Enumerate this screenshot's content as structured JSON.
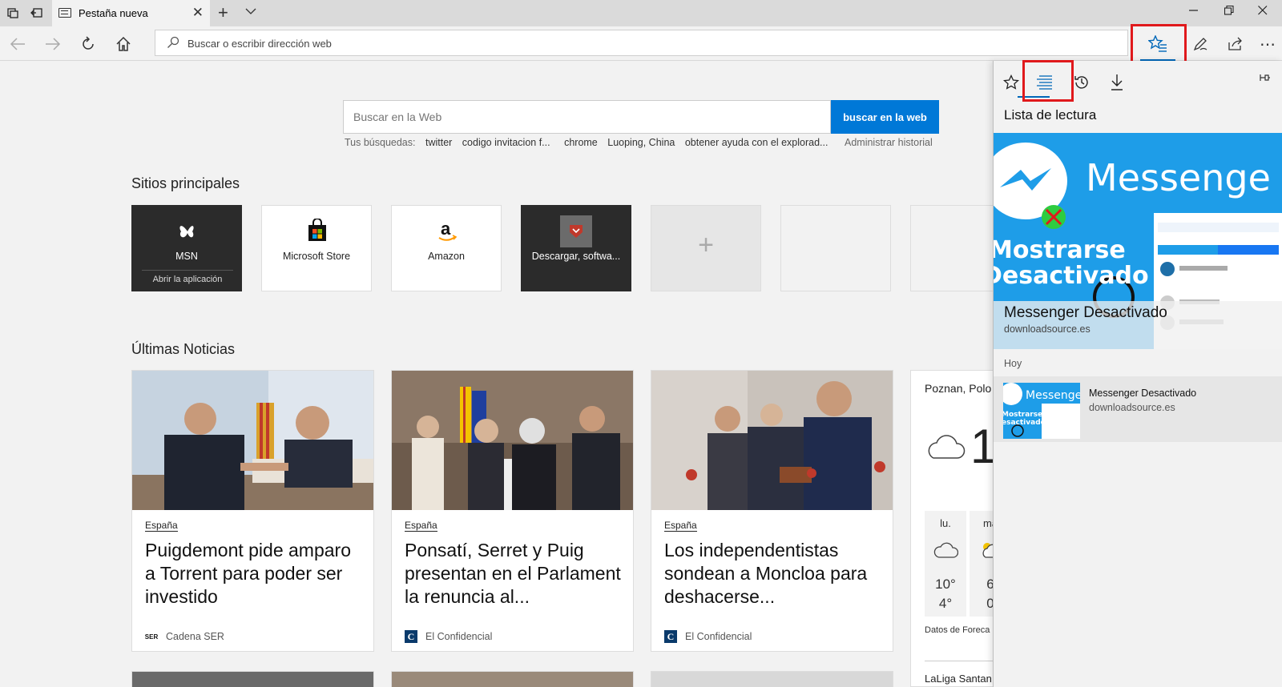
{
  "browser": {
    "tab": {
      "title": "Pestaña nueva"
    },
    "address": {
      "placeholder": "Buscar o escribir dirección web"
    }
  },
  "search": {
    "placeholder": "Buscar en la Web",
    "button": "buscar en la web",
    "recent_label": "Tus búsquedas:",
    "recent": [
      "twitter",
      "codigo invitacion f...",
      "chrome",
      "Luoping, China",
      "obtener ayuda con el explorad..."
    ],
    "manage": "Administrar historial"
  },
  "top_sites": {
    "title": "Sitios principales",
    "items": [
      {
        "label": "MSN",
        "sub": "Abrir la aplicación"
      },
      {
        "label": "Microsoft Store"
      },
      {
        "label": "Amazon"
      },
      {
        "label": "Descargar, softwa..."
      }
    ]
  },
  "news": {
    "title": "Últimas Noticias",
    "items": [
      {
        "category": "España",
        "headline": "Puigdemont pide amparo a Torrent para poder ser investido",
        "source": "Cadena SER",
        "source_icon": "SER"
      },
      {
        "category": "España",
        "headline": "Ponsatí, Serret y Puig presentan en el Parlament la renuncia al...",
        "source": "El Confidencial",
        "source_icon": "C"
      },
      {
        "category": "España",
        "headline": "Los independentistas sondean a Moncloa para deshacerse...",
        "source": "El Confidencial",
        "source_icon": "C"
      }
    ]
  },
  "weather": {
    "city": "Poznan, Polo",
    "temp": "1",
    "days": [
      {
        "name": "lu.",
        "hi": "10°",
        "lo": "4°"
      },
      {
        "name": "ma",
        "hi": "6",
        "lo": "0"
      }
    ],
    "credit": "Datos de Foreca |",
    "footer": "LaLiga Santan"
  },
  "hub": {
    "title": "Lista de lectura",
    "featured": {
      "image_text_1": "Messenge",
      "image_text_2": "Mostrarse",
      "image_text_3": "Desactivado",
      "title": "Messenger Desactivado",
      "source": "downloadsource.es"
    },
    "group": "Hoy",
    "items": [
      {
        "title": "Messenger Desactivado",
        "source": "downloadsource.es",
        "thumb_text_1": "Messenge",
        "thumb_text_2": "Mostrarse",
        "thumb_text_3": "esactivado"
      }
    ]
  },
  "colors": {
    "accent": "#0078d7",
    "highlight": "#e0191c",
    "messenger_bg": "#1e9de8"
  }
}
